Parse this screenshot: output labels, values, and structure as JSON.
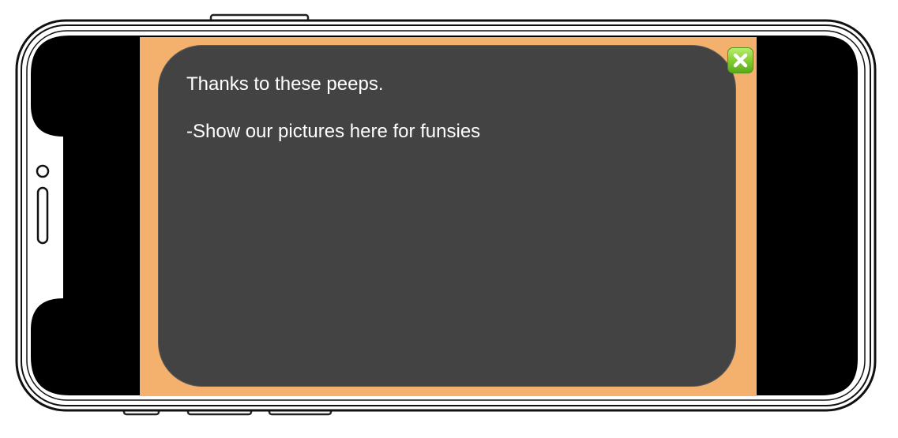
{
  "dialog": {
    "lines": [
      "Thanks to these peeps.",
      "-Show our pictures here for funsies"
    ]
  },
  "close_button": {
    "icon": "close-icon"
  },
  "colors": {
    "game_background": "#f4b16d",
    "dialog_background": "#434343",
    "dialog_text": "#ffffff",
    "close_button": "#7fcc2e"
  }
}
